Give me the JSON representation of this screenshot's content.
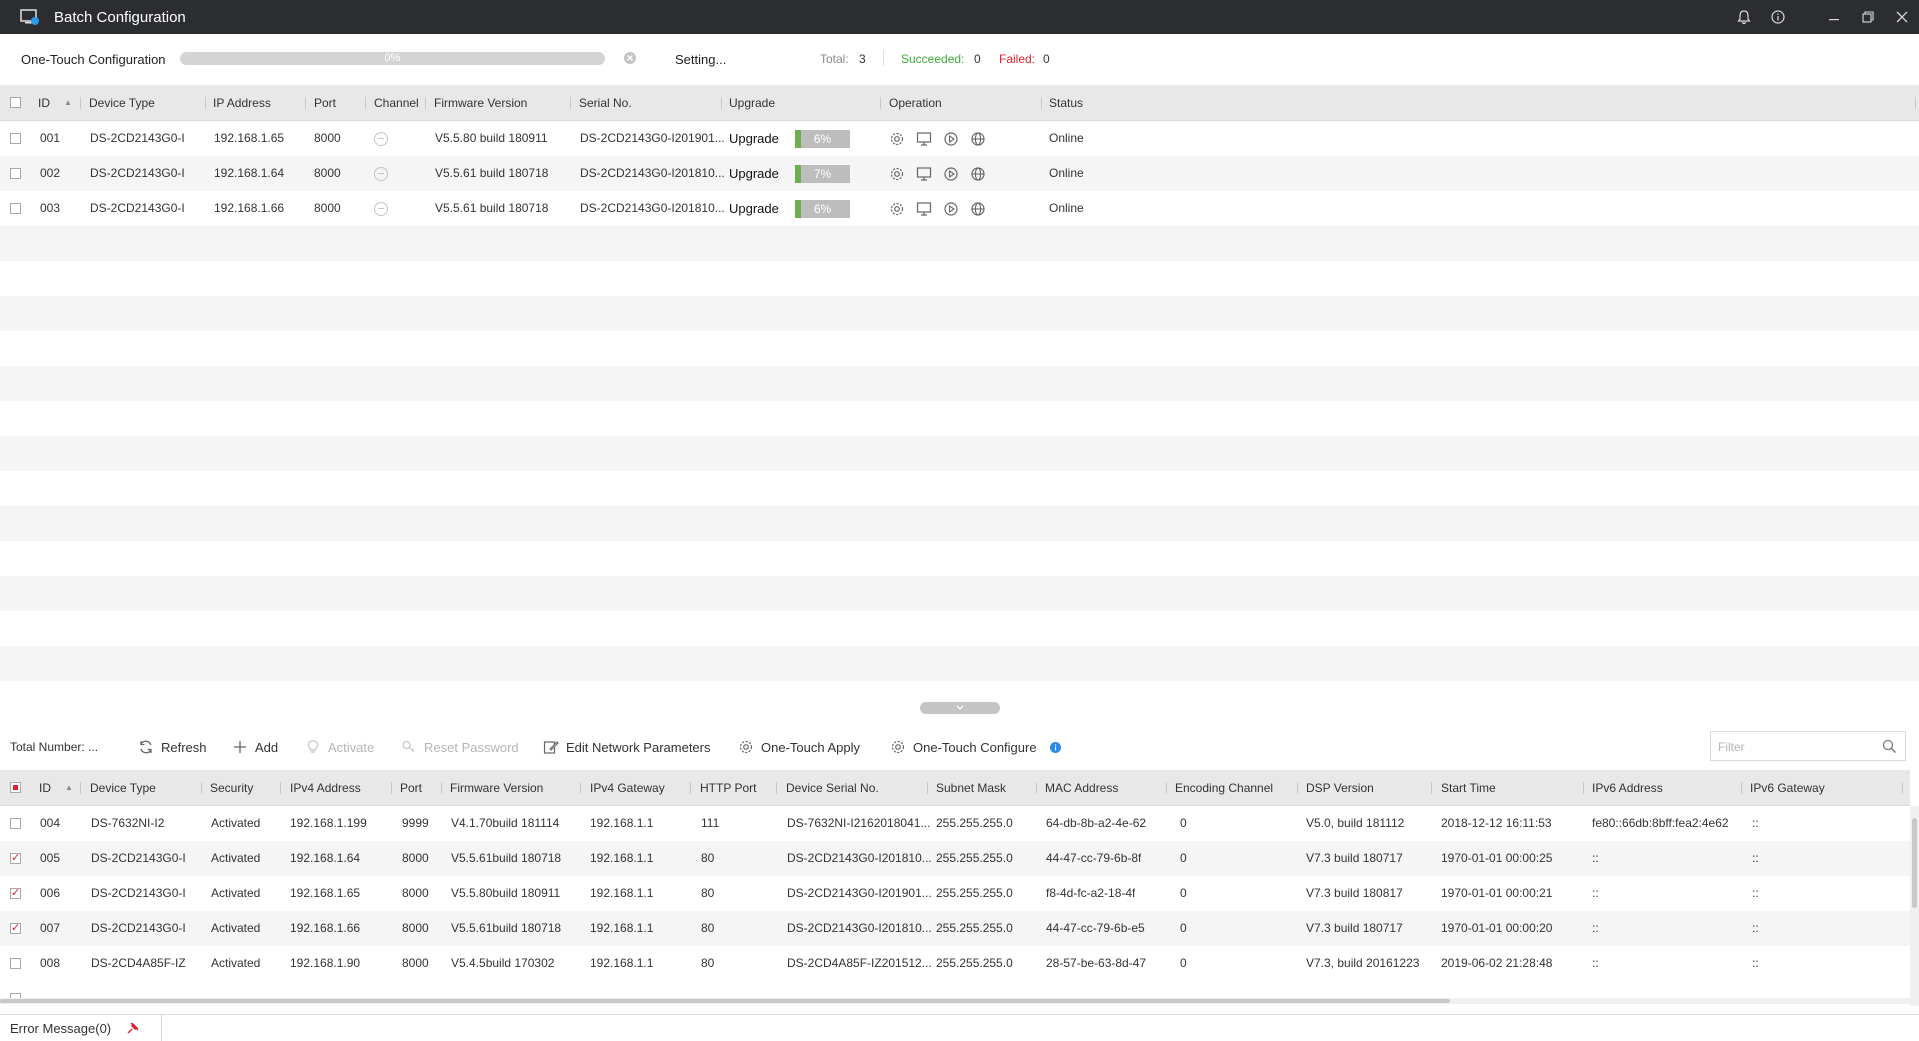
{
  "window": {
    "title": "Batch Configuration"
  },
  "config_status": {
    "label": "One-Touch Configuration",
    "progress_text": "0%",
    "progress": 0,
    "setting_text": "Setting...",
    "total_label": "Total:",
    "total_value": "3",
    "succeeded_label": "Succeeded:",
    "succeeded_value": "0",
    "failed_label": "Failed:",
    "failed_value": "0"
  },
  "upgrade_table": {
    "columns": [
      "ID",
      "Device Type",
      "IP Address",
      "Port",
      "Channel",
      "Firmware Version",
      "Serial No.",
      "Upgrade",
      "Operation",
      "Status"
    ],
    "rows": [
      {
        "id": "001",
        "device_type": "DS-2CD2143G0-I",
        "ip": "192.168.1.65",
        "port": "8000",
        "firmware": "V5.5.80 build 180911",
        "serial": "DS-2CD2143G0-I201901...",
        "upgrade_label": "Upgrade",
        "progress_text": "6%",
        "progress": 0.06,
        "status": "Online"
      },
      {
        "id": "002",
        "device_type": "DS-2CD2143G0-I",
        "ip": "192.168.1.64",
        "port": "8000",
        "firmware": "V5.5.61 build 180718",
        "serial": "DS-2CD2143G0-I201810...",
        "upgrade_label": "Upgrade",
        "progress_text": "7%",
        "progress": 0.07,
        "status": "Online"
      },
      {
        "id": "003",
        "device_type": "DS-2CD2143G0-I",
        "ip": "192.168.1.66",
        "port": "8000",
        "firmware": "V5.5.61 build 180718",
        "serial": "DS-2CD2143G0-I201810...",
        "upgrade_label": "Upgrade",
        "progress_text": "6%",
        "progress": 0.06,
        "status": "Online"
      }
    ]
  },
  "toolbar": {
    "total_number": "Total Number: ...",
    "refresh": "Refresh",
    "add": "Add",
    "activate": "Activate",
    "reset_password": "Reset Password",
    "edit_network": "Edit Network Parameters",
    "one_touch_apply": "One-Touch Apply",
    "one_touch_configure": "One-Touch Configure",
    "filter_placeholder": "Filter"
  },
  "device_table": {
    "columns": [
      "ID",
      "Device Type",
      "Security",
      "IPv4 Address",
      "Port",
      "Firmware Version",
      "IPv4 Gateway",
      "HTTP Port",
      "Device Serial No.",
      "Subnet Mask",
      "MAC Address",
      "Encoding Channel",
      "DSP Version",
      "Start Time",
      "IPv6 Address",
      "IPv6 Gateway"
    ],
    "rows": [
      {
        "checked": false,
        "id": "004",
        "device_type": "DS-7632NI-I2",
        "security": "Activated",
        "ipv4": "192.168.1.199",
        "port": "9999",
        "firmware": "V4.1.70build 181114",
        "gateway": "192.168.1.1",
        "http_port": "111",
        "serial": "DS-7632NI-I2162018041...",
        "mask": "255.255.255.0",
        "mac": "64-db-8b-a2-4e-62",
        "enc_channel": "0",
        "dsp": "V5.0, build 181112",
        "start_time": "2018-12-12 16:11:53",
        "ipv6": "fe80::66db:8bff:fea2:4e62",
        "ipv6_gw": "::"
      },
      {
        "checked": true,
        "id": "005",
        "device_type": "DS-2CD2143G0-I",
        "security": "Activated",
        "ipv4": "192.168.1.64",
        "port": "8000",
        "firmware": "V5.5.61build 180718",
        "gateway": "192.168.1.1",
        "http_port": "80",
        "serial": "DS-2CD2143G0-I201810...",
        "mask": "255.255.255.0",
        "mac": "44-47-cc-79-6b-8f",
        "enc_channel": "0",
        "dsp": "V7.3 build 180717",
        "start_time": "1970-01-01 00:00:25",
        "ipv6": "::",
        "ipv6_gw": "::"
      },
      {
        "checked": true,
        "id": "006",
        "device_type": "DS-2CD2143G0-I",
        "security": "Activated",
        "ipv4": "192.168.1.65",
        "port": "8000",
        "firmware": "V5.5.80build 180911",
        "gateway": "192.168.1.1",
        "http_port": "80",
        "serial": "DS-2CD2143G0-I201901...",
        "mask": "255.255.255.0",
        "mac": "f8-4d-fc-a2-18-4f",
        "enc_channel": "0",
        "dsp": "V7.3 build 180817",
        "start_time": "1970-01-01 00:00:21",
        "ipv6": "::",
        "ipv6_gw": "::"
      },
      {
        "checked": true,
        "id": "007",
        "device_type": "DS-2CD2143G0-I",
        "security": "Activated",
        "ipv4": "192.168.1.66",
        "port": "8000",
        "firmware": "V5.5.61build 180718",
        "gateway": "192.168.1.1",
        "http_port": "80",
        "serial": "DS-2CD2143G0-I201810...",
        "mask": "255.255.255.0",
        "mac": "44-47-cc-79-6b-e5",
        "enc_channel": "0",
        "dsp": "V7.3 build 180717",
        "start_time": "1970-01-01 00:00:20",
        "ipv6": "::",
        "ipv6_gw": "::"
      },
      {
        "checked": false,
        "id": "008",
        "device_type": "DS-2CD4A85F-IZ",
        "security": "Activated",
        "ipv4": "192.168.1.90",
        "port": "8000",
        "firmware": "V5.4.5build 170302",
        "gateway": "192.168.1.1",
        "http_port": "80",
        "serial": "DS-2CD4A85F-IZ201512...",
        "mask": "255.255.255.0",
        "mac": "28-57-be-63-8d-47",
        "enc_channel": "0",
        "dsp": "V7.3, build 20161223",
        "start_time": "2019-06-02 21:28:48",
        "ipv6": "::",
        "ipv6_gw": "::"
      }
    ]
  },
  "footer": {
    "error_message": "Error Message(0)"
  },
  "colors": {
    "accent": "#d9232e",
    "success": "#3daa35",
    "progress": "#6ab04c",
    "titlebar": "#2b2d31"
  }
}
